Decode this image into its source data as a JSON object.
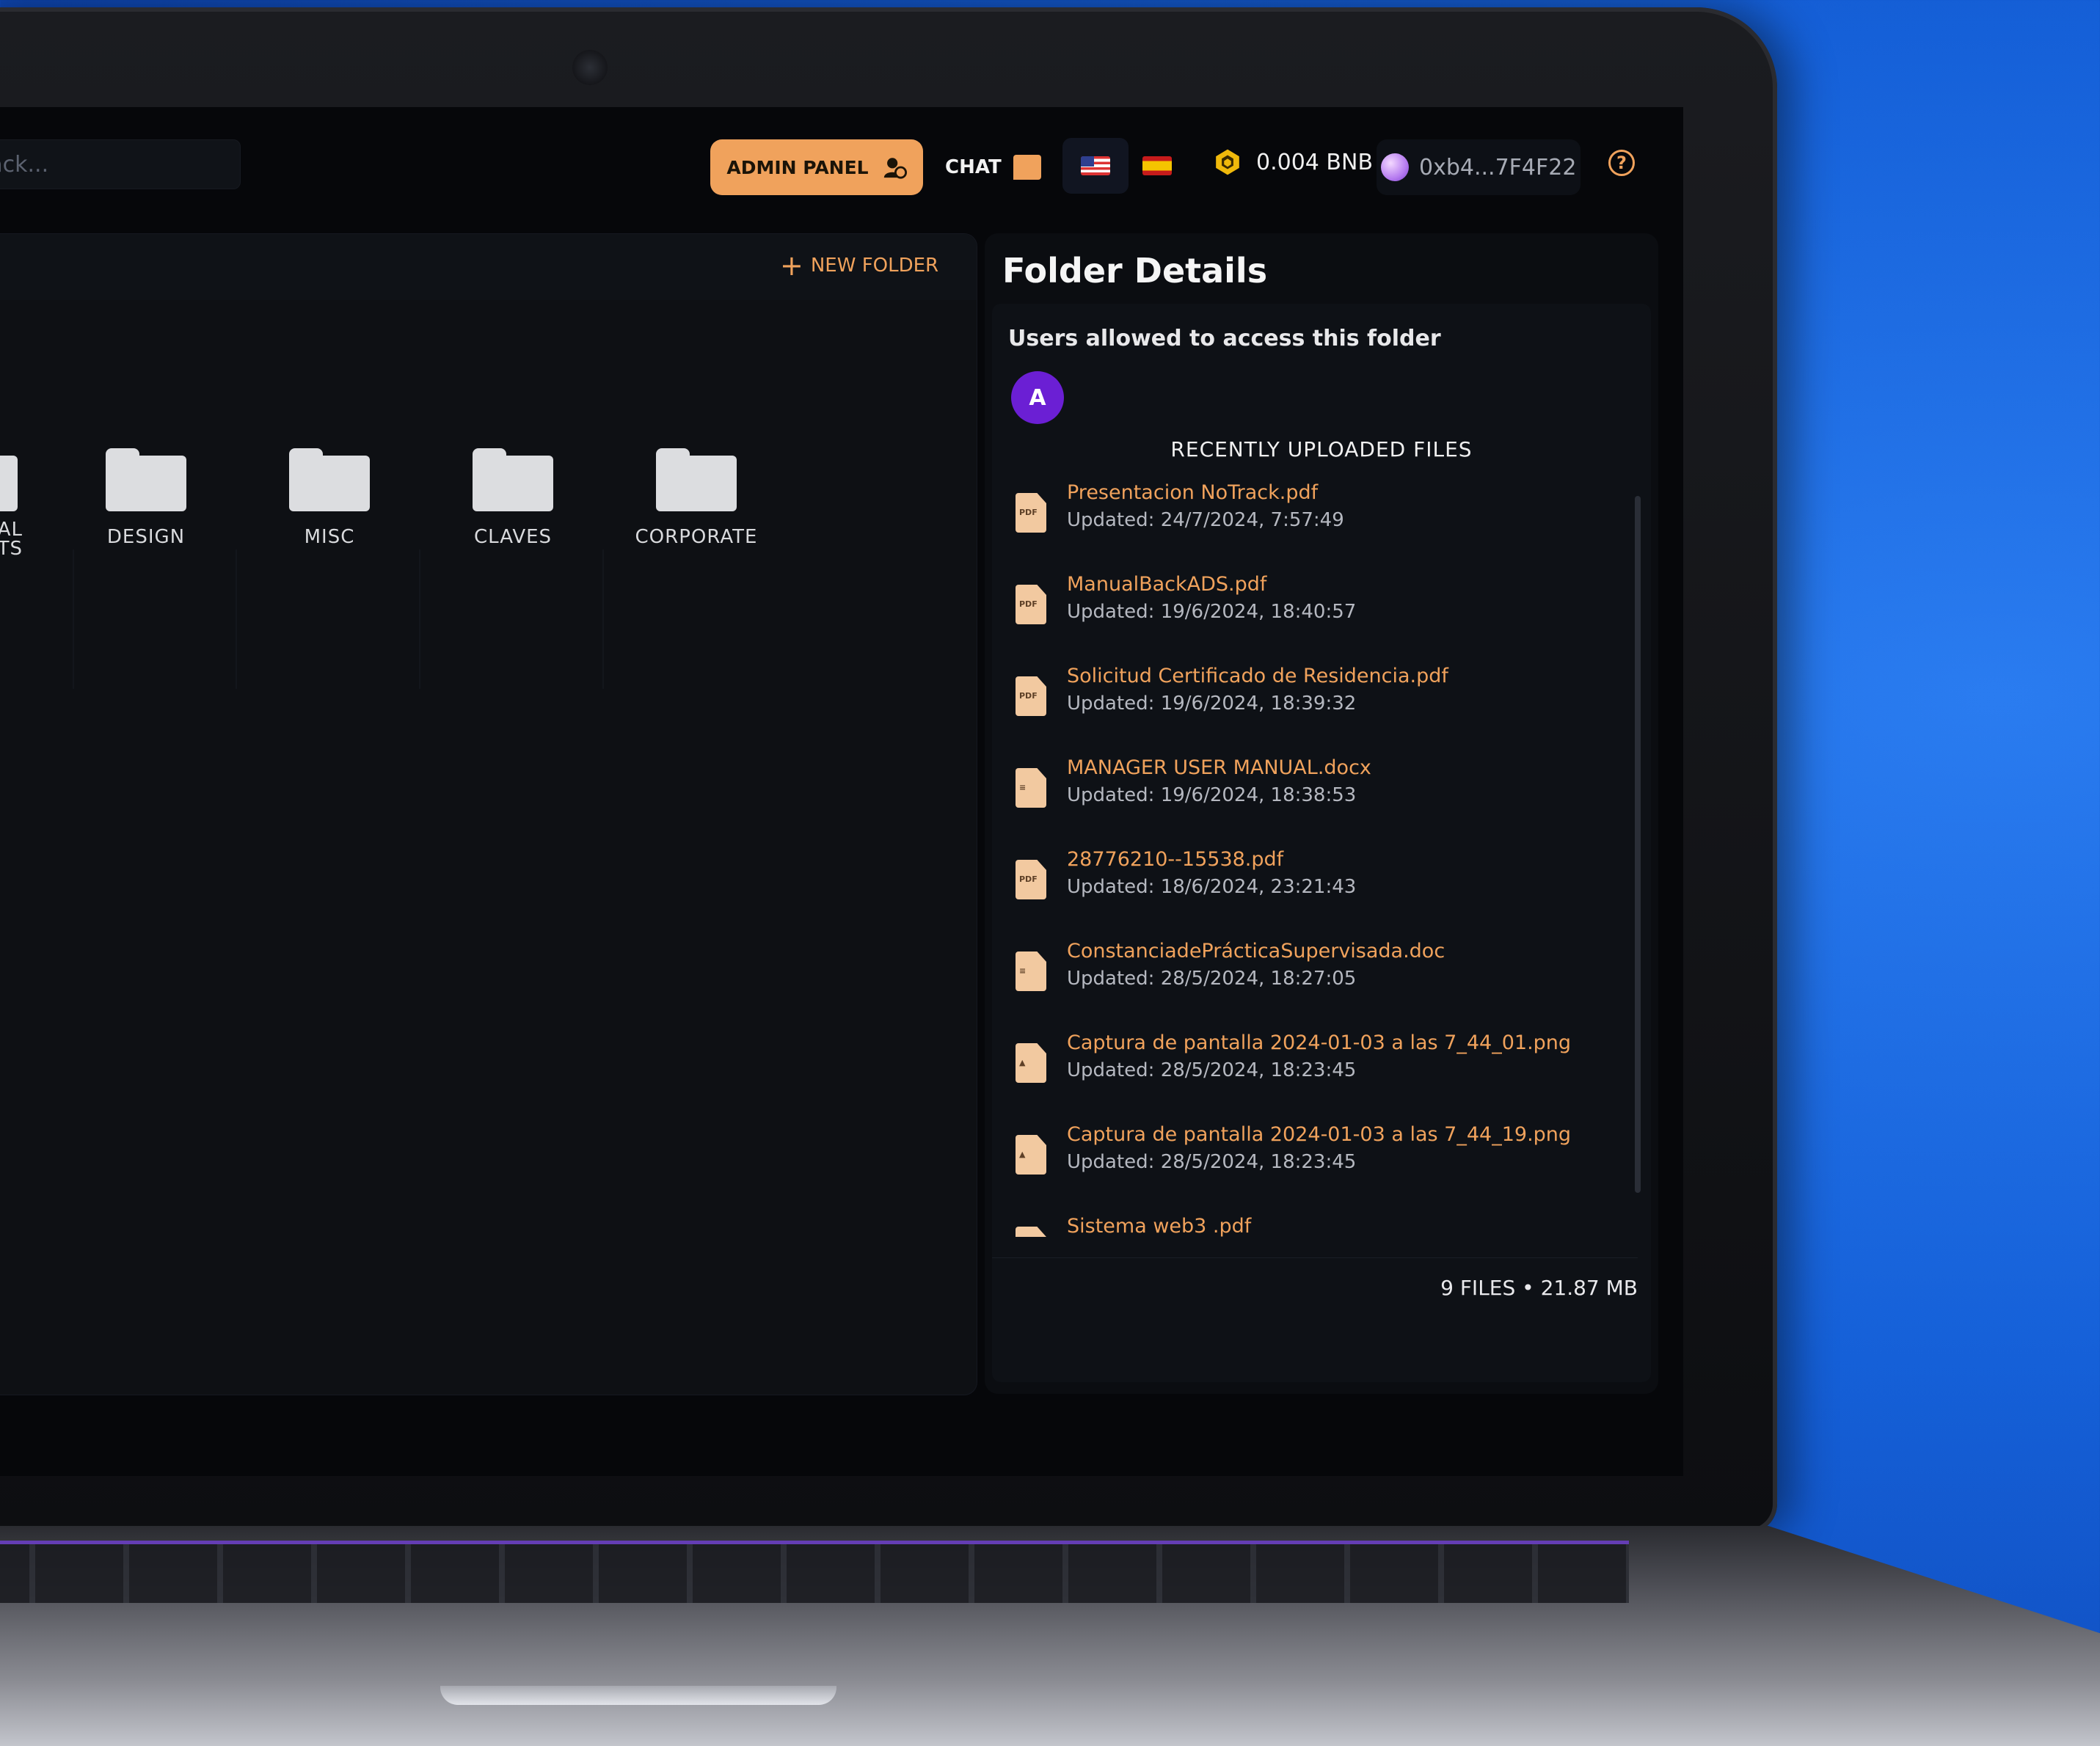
{
  "topbar": {
    "search_placeholder": "Track...",
    "admin_label": "ADMIN PANEL",
    "chat_label": "CHAT",
    "balance": "0.004 BNB",
    "wallet": "0xb4...7F4F22"
  },
  "folders": {
    "new_folder_label": "NEW FOLDER",
    "items": [
      {
        "label": "AL\nMENTS"
      },
      {
        "label": "DESIGN"
      },
      {
        "label": "MISC"
      },
      {
        "label": "CLAVES"
      },
      {
        "label": "CORPORATE"
      }
    ]
  },
  "details": {
    "title": "Folder Details",
    "users_label": "Users allowed to access this folder",
    "avatar_letter": "A",
    "recent_heading": "RECENTLY UPLOADED FILES",
    "files": [
      {
        "name": "Presentacion NoTrack.pdf",
        "updated": "Updated: 24/7/2024, 7:57:49",
        "type": "pdf"
      },
      {
        "name": "ManualBackADS.pdf",
        "updated": "Updated: 19/6/2024, 18:40:57",
        "type": "pdf"
      },
      {
        "name": "Solicitud Certificado de Residencia.pdf",
        "updated": "Updated: 19/6/2024, 18:39:32",
        "type": "pdf"
      },
      {
        "name": "MANAGER USER MANUAL.docx",
        "updated": "Updated: 19/6/2024, 18:38:53",
        "type": "doc"
      },
      {
        "name": "28776210--15538.pdf",
        "updated": "Updated: 18/6/2024, 23:21:43",
        "type": "pdf"
      },
      {
        "name": "ConstanciadePrácticaSupervisada.doc",
        "updated": "Updated: 28/5/2024, 18:27:05",
        "type": "doc"
      },
      {
        "name": "Captura de pantalla 2024-01-03 a las 7_44_01.png",
        "updated": "Updated: 28/5/2024, 18:23:45",
        "type": "img"
      },
      {
        "name": "Captura de pantalla 2024-01-03 a las 7_44_19.png",
        "updated": "Updated: 28/5/2024, 18:23:45",
        "type": "img"
      },
      {
        "name": "Sistema web3 .pdf",
        "updated": "",
        "type": "pdf"
      }
    ],
    "summary": "9 FILES • 21.87 MB"
  }
}
